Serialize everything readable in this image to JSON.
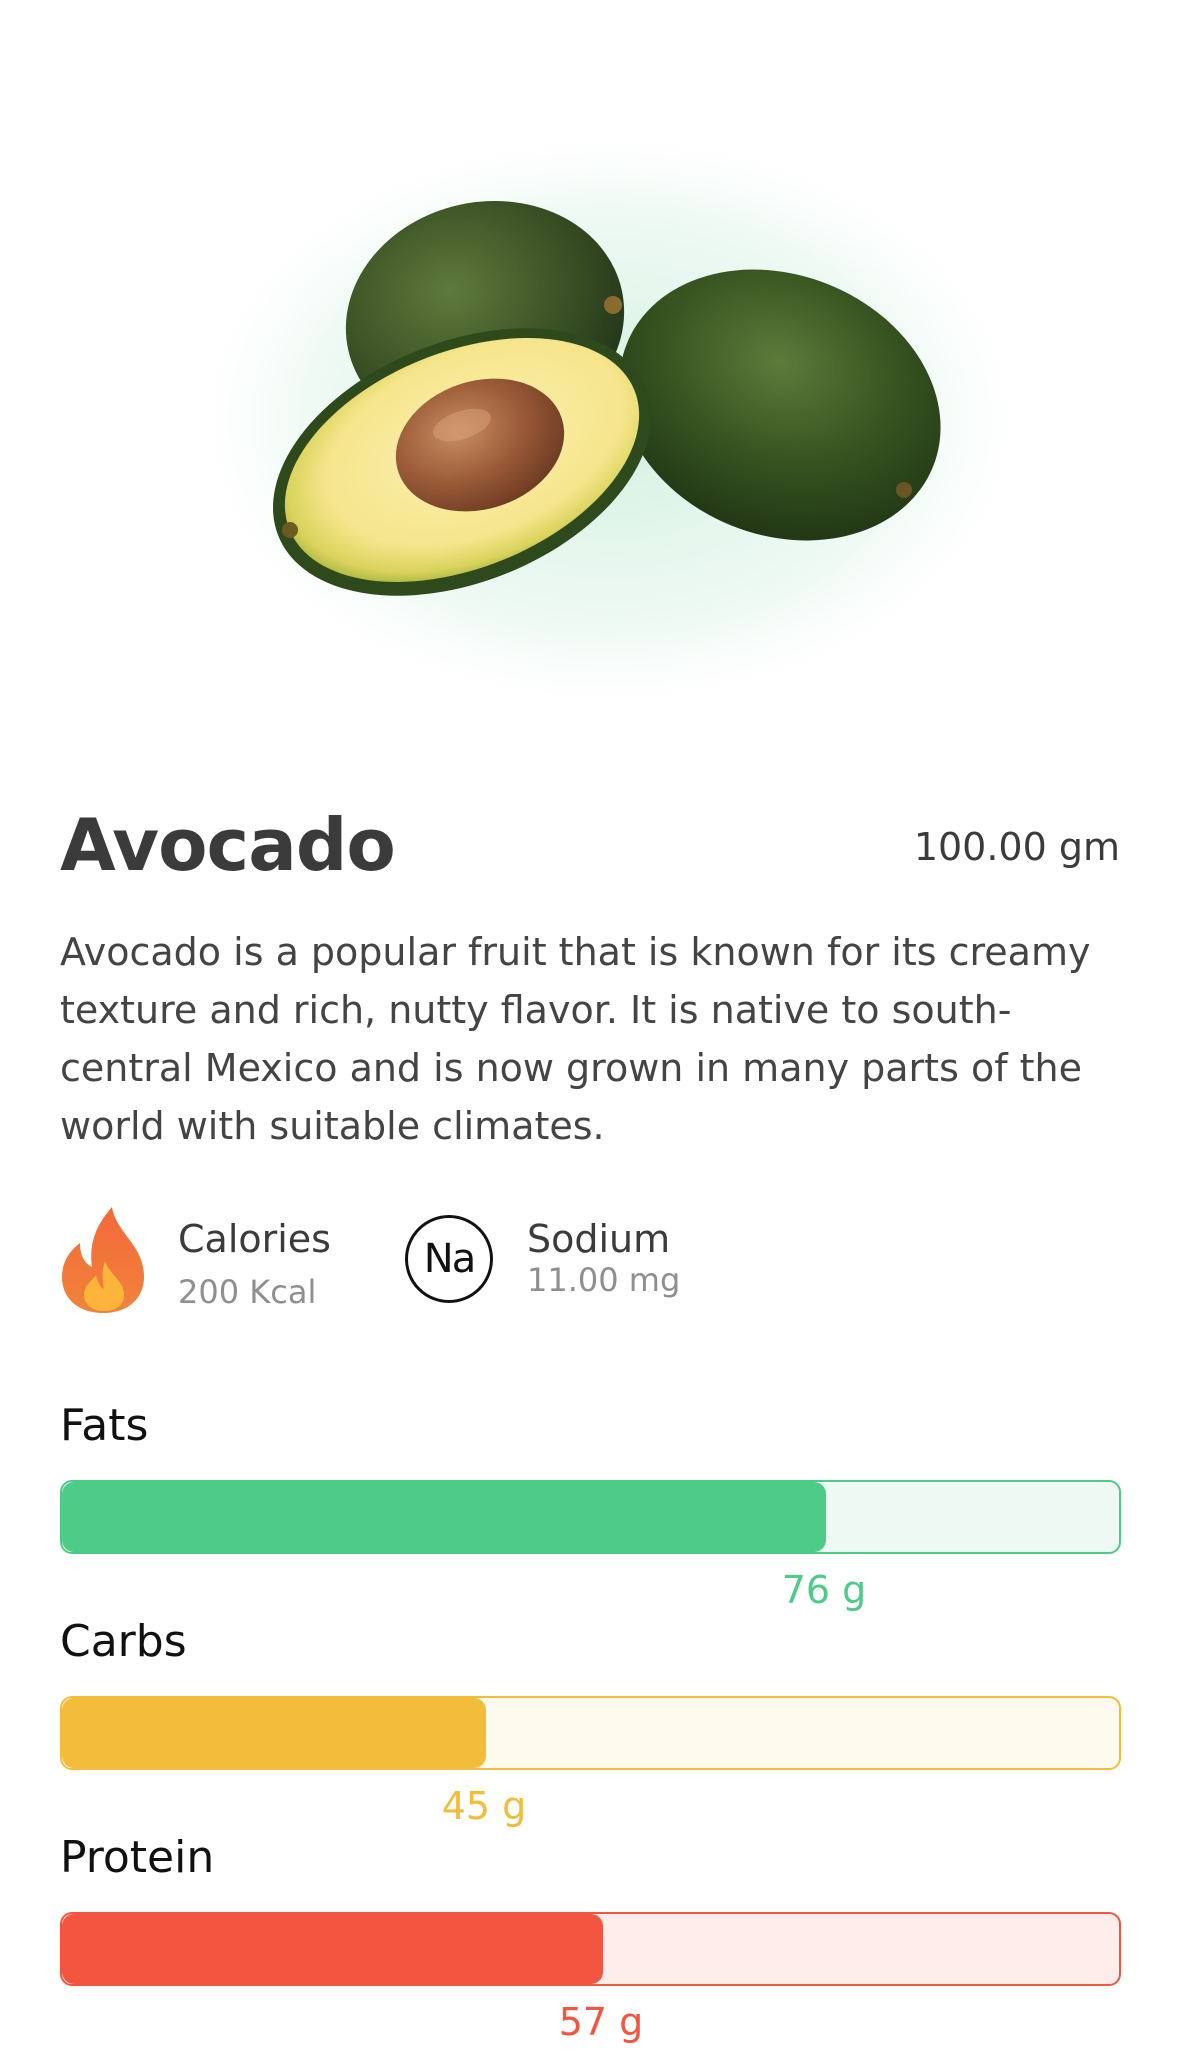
{
  "food": {
    "name": "Avocado",
    "serving": "100.00 gm",
    "description": "Avocado is a popular fruit that is known for its creamy texture and rich, nutty flavor. It is native to south-central Mexico and is now grown in many parts of the world with suitable climates."
  },
  "stats": {
    "calories": {
      "label": "Calories",
      "value": "200 Kcal",
      "icon": "flame-icon"
    },
    "sodium": {
      "label": "Sodium",
      "value": "11.00 mg",
      "icon": "sodium-icon",
      "symbol": "Na"
    }
  },
  "macros": [
    {
      "label": "Fats",
      "value": "76 g",
      "fraction": 0.72,
      "color": "#4ecb87",
      "track": "#eef9f3"
    },
    {
      "label": "Carbs",
      "value": "45 g",
      "fraction": 0.4,
      "color": "#f2bd3b",
      "track": "#fffaee"
    },
    {
      "label": "Protein",
      "value": "57 g",
      "fraction": 0.51,
      "color": "#f45540",
      "track": "#ffedeb"
    }
  ]
}
